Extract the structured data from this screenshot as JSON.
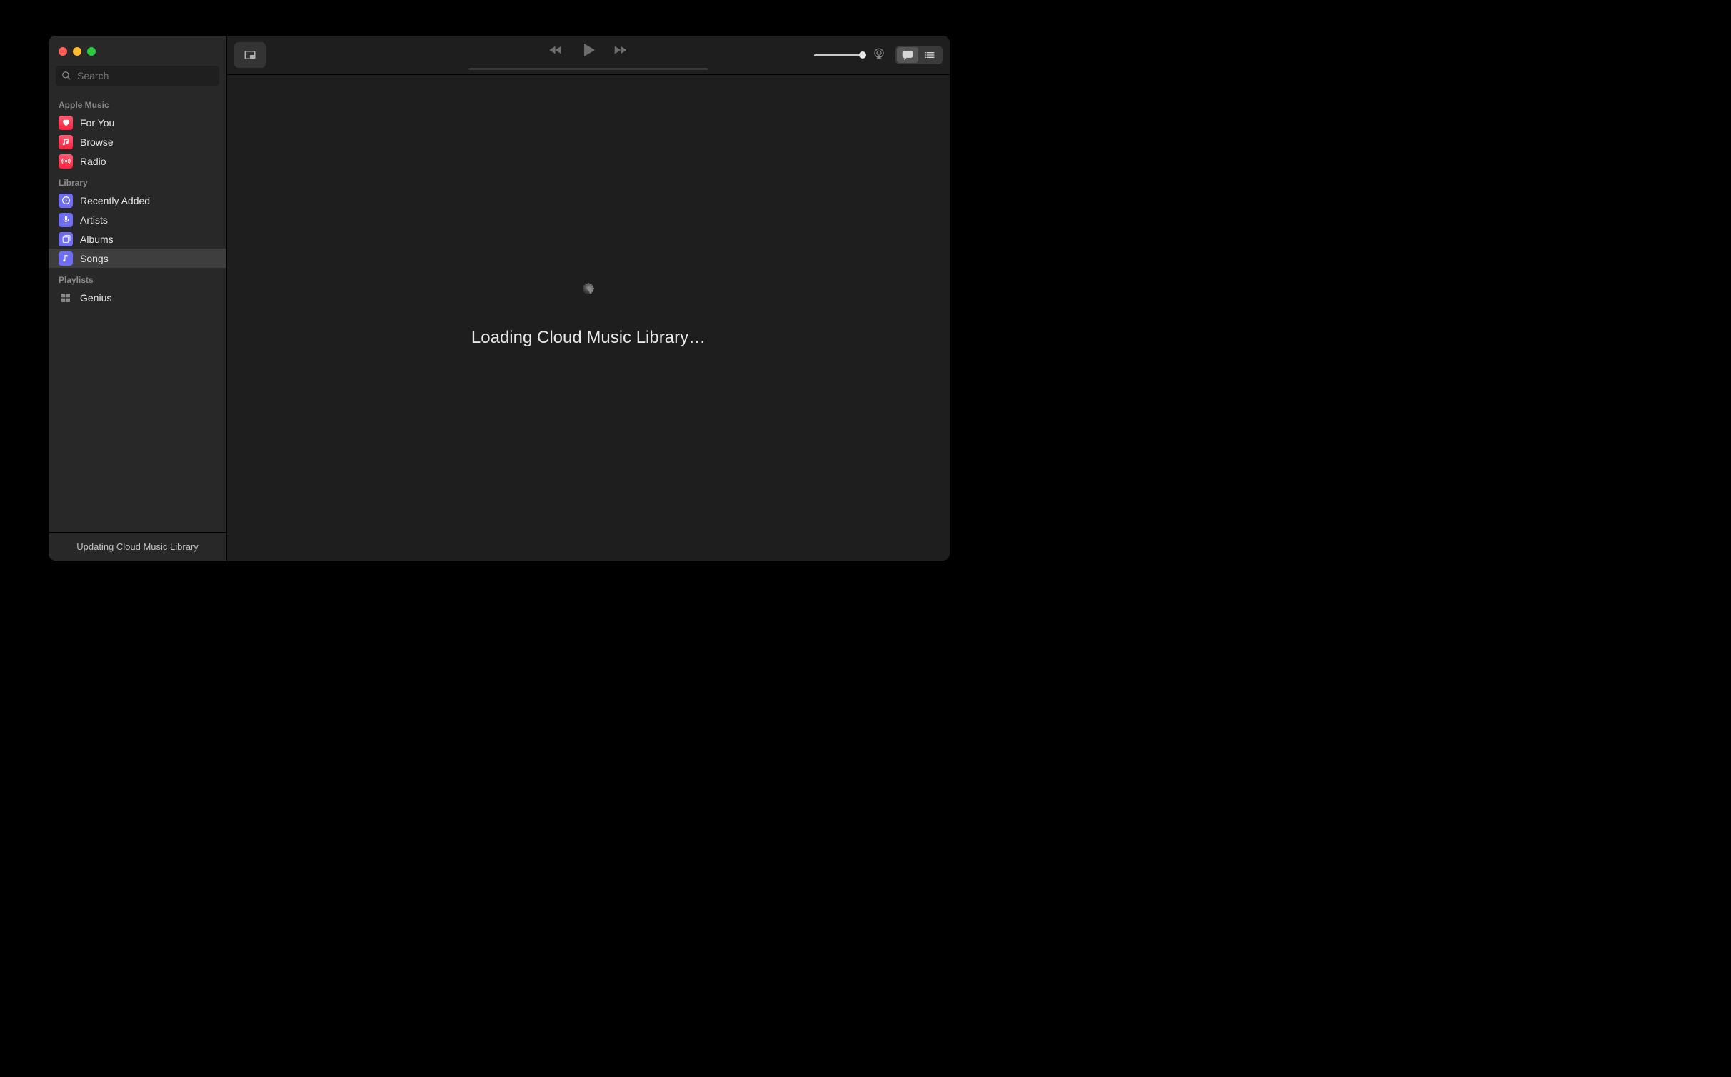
{
  "search": {
    "placeholder": "Search"
  },
  "sidebar": {
    "sections": [
      {
        "header": "Apple Music",
        "items": [
          {
            "label": "For You"
          },
          {
            "label": "Browse"
          },
          {
            "label": "Radio"
          }
        ]
      },
      {
        "header": "Library",
        "items": [
          {
            "label": "Recently Added"
          },
          {
            "label": "Artists"
          },
          {
            "label": "Albums"
          },
          {
            "label": "Songs"
          }
        ]
      },
      {
        "header": "Playlists",
        "items": [
          {
            "label": "Genius"
          }
        ]
      }
    ],
    "footer": "Updating Cloud Music Library"
  },
  "main": {
    "loading_text": "Loading Cloud Music Library…"
  },
  "colors": {
    "accent_pink_top": "#fb5c74",
    "accent_pink_bottom": "#fa233b",
    "accent_purple": "#6f6df0"
  }
}
